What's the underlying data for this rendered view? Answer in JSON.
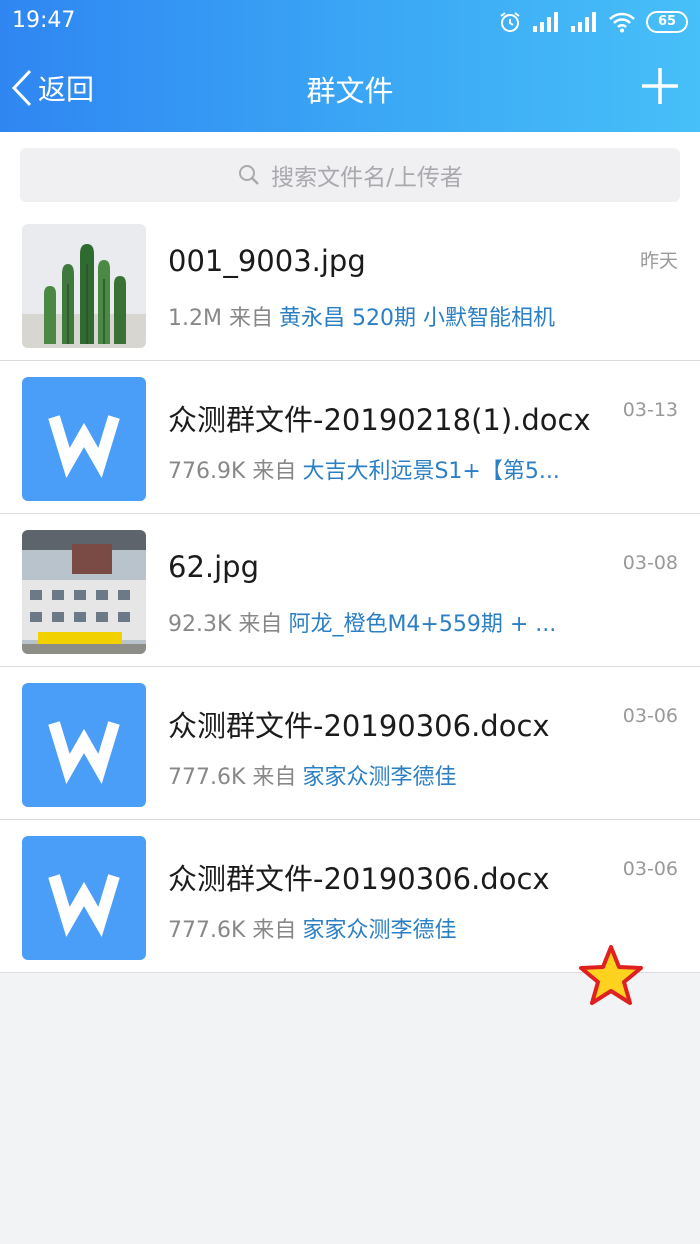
{
  "status_bar": {
    "time": "19:47",
    "battery": "65"
  },
  "nav": {
    "back_label": "返回",
    "title": "群文件"
  },
  "search": {
    "placeholder": "搜索文件名/上传者"
  },
  "files": [
    {
      "name": "001_9003.jpg",
      "size": "1.2M",
      "from_label": "来自",
      "uploader": "黄永昌 520期 小默智能相机",
      "date": "昨天",
      "thumb": "cactus-image"
    },
    {
      "name": "众测群文件-20190218(1).docx",
      "size": "776.9K",
      "from_label": "来自",
      "uploader": "大吉大利远景S1+【第5...",
      "date": "03-13",
      "thumb": "word-icon"
    },
    {
      "name": "62.jpg",
      "size": "92.3K",
      "from_label": "来自",
      "uploader": "阿龙_橙色M4+559期 + ...",
      "date": "03-08",
      "thumb": "building-photo"
    },
    {
      "name": "众测群文件-20190306.docx",
      "size": "777.6K",
      "from_label": "来自",
      "uploader": "家家众测李德佳",
      "date": "03-06",
      "thumb": "word-icon"
    },
    {
      "name": "众测群文件-20190306.docx",
      "size": "777.6K",
      "from_label": "来自",
      "uploader": "家家众测李德佳",
      "date": "03-06",
      "thumb": "word-icon"
    }
  ],
  "colors": {
    "header_start": "#2f86f2",
    "header_end": "#47bff8",
    "link": "#2b7fc5",
    "word_tile": "#4a9ef8",
    "star": "#ffd21f"
  }
}
